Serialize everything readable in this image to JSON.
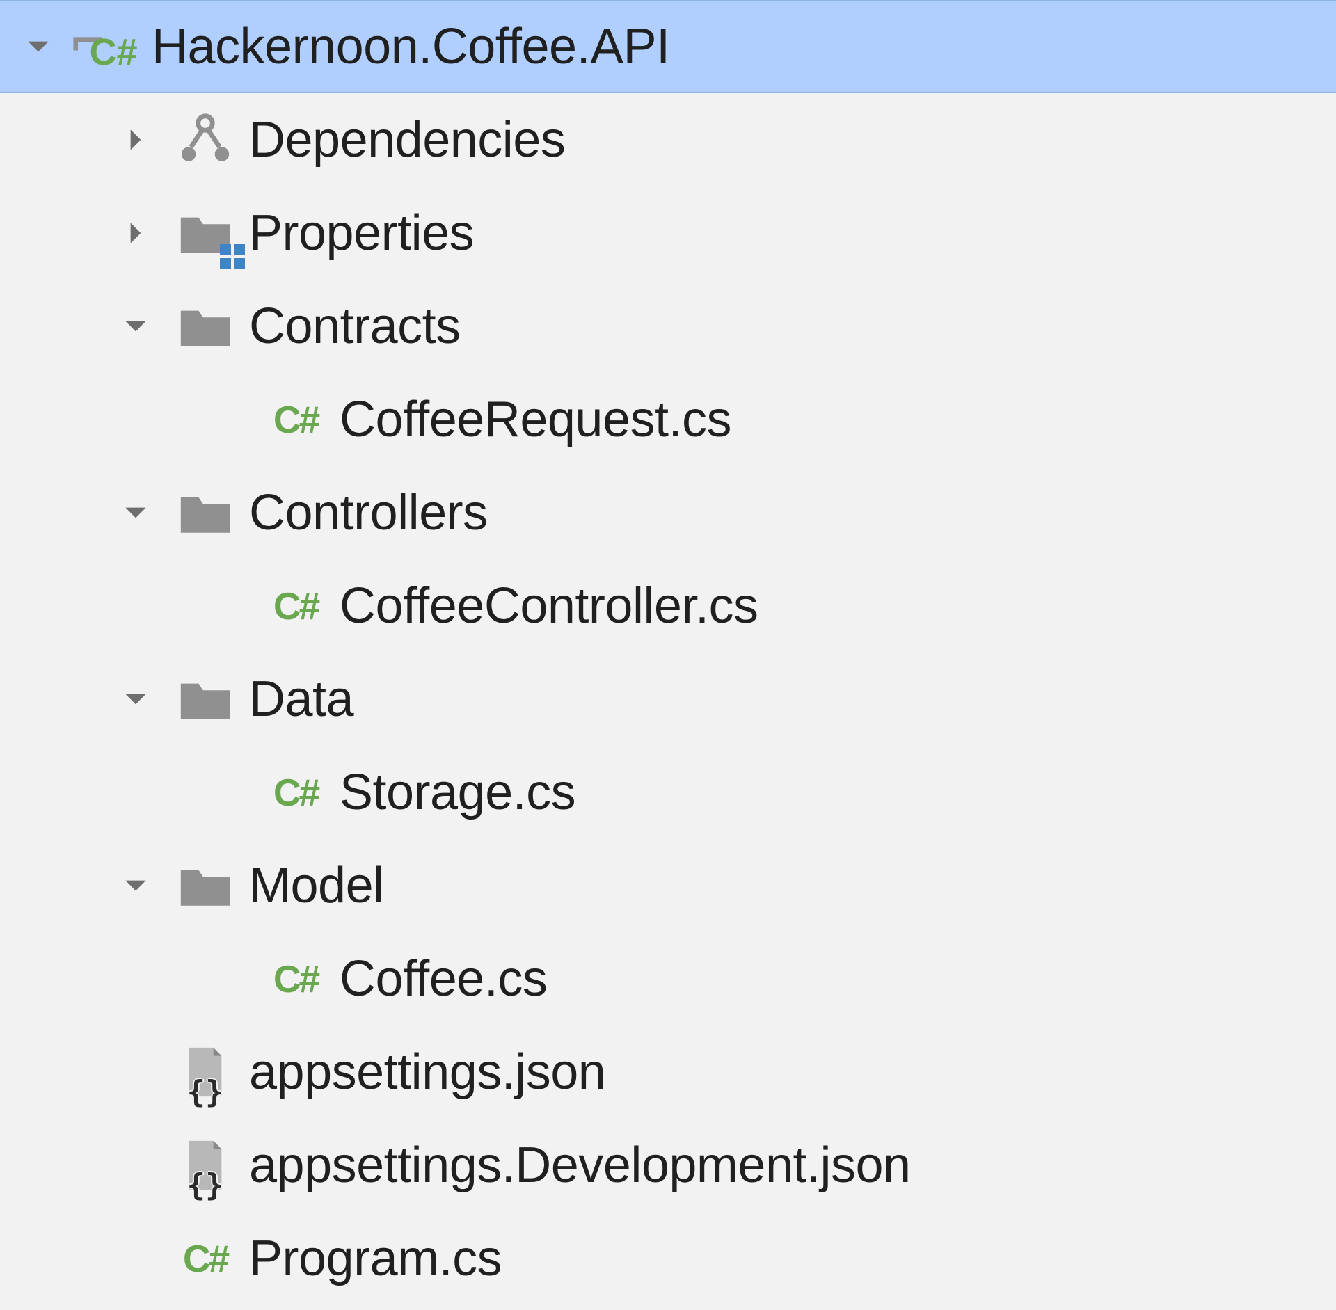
{
  "tree": {
    "root": {
      "label": "Hackernoon.Coffee.API",
      "icon": "csproj",
      "expanded": true,
      "selected": true
    },
    "items": [
      {
        "label": "Dependencies",
        "icon": "dependencies",
        "depth": 1,
        "expandable": true,
        "expanded": false
      },
      {
        "label": "Properties",
        "icon": "properties-folder",
        "depth": 1,
        "expandable": true,
        "expanded": false
      },
      {
        "label": "Contracts",
        "icon": "folder",
        "depth": 1,
        "expandable": true,
        "expanded": true
      },
      {
        "label": "CoffeeRequest.cs",
        "icon": "csharp",
        "depth": 2,
        "expandable": false
      },
      {
        "label": "Controllers",
        "icon": "folder",
        "depth": 1,
        "expandable": true,
        "expanded": true
      },
      {
        "label": "CoffeeController.cs",
        "icon": "csharp",
        "depth": 2,
        "expandable": false
      },
      {
        "label": "Data",
        "icon": "folder",
        "depth": 1,
        "expandable": true,
        "expanded": true
      },
      {
        "label": "Storage.cs",
        "icon": "csharp",
        "depth": 2,
        "expandable": false
      },
      {
        "label": "Model",
        "icon": "folder",
        "depth": 1,
        "expandable": true,
        "expanded": true
      },
      {
        "label": "Coffee.cs",
        "icon": "csharp",
        "depth": 2,
        "expandable": false
      },
      {
        "label": "appsettings.json",
        "icon": "json-config",
        "depth": 1,
        "expandable": false
      },
      {
        "label": "appsettings.Development.json",
        "icon": "json-config",
        "depth": 1,
        "expandable": false
      },
      {
        "label": "Program.cs",
        "icon": "csharp",
        "depth": 1,
        "expandable": false
      }
    ]
  },
  "colors": {
    "selection": "#b0cfff",
    "folder": "#909090",
    "accent_green": "#6aa84f",
    "accent_blue": "#3d85c6"
  }
}
